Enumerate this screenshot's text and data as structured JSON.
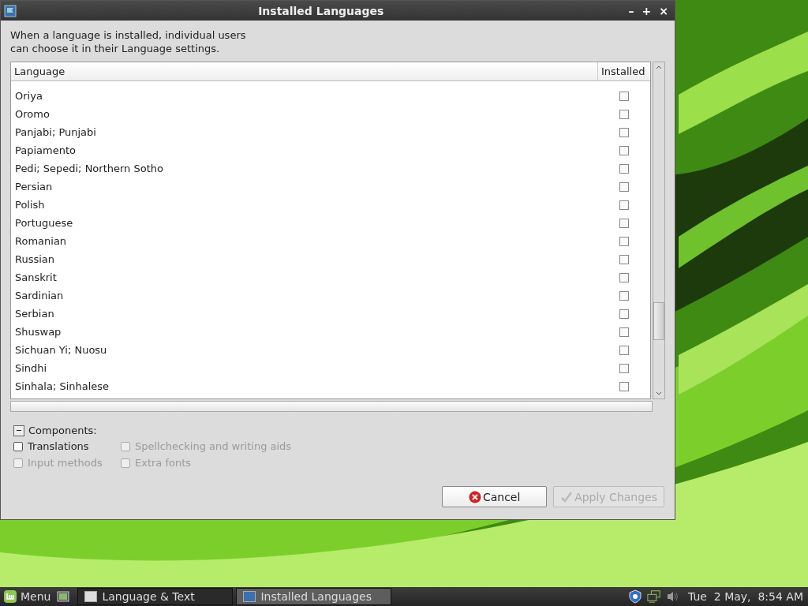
{
  "window": {
    "title": "Installed Languages",
    "controls": [
      "–",
      "+",
      "×"
    ]
  },
  "description": "When a language is installed, individual users\ncan choose it in their Language settings.",
  "table": {
    "columns": [
      "Language",
      "Installed"
    ],
    "rows": [
      {
        "name": "Oriya",
        "installed": false
      },
      {
        "name": "Oromo",
        "installed": false
      },
      {
        "name": "Panjabi; Punjabi",
        "installed": false
      },
      {
        "name": "Papiamento",
        "installed": false
      },
      {
        "name": "Pedi; Sepedi; Northern Sotho",
        "installed": false
      },
      {
        "name": "Persian",
        "installed": false
      },
      {
        "name": "Polish",
        "installed": false
      },
      {
        "name": "Portuguese",
        "installed": false
      },
      {
        "name": "Romanian",
        "installed": false
      },
      {
        "name": "Russian",
        "installed": false
      },
      {
        "name": "Sanskrit",
        "installed": false
      },
      {
        "name": "Sardinian",
        "installed": false
      },
      {
        "name": "Serbian",
        "installed": false
      },
      {
        "name": "Shuswap",
        "installed": false
      },
      {
        "name": "Sichuan Yi; Nuosu",
        "installed": false
      },
      {
        "name": "Sindhi",
        "installed": false
      },
      {
        "name": "Sinhala; Sinhalese",
        "installed": false
      }
    ]
  },
  "components": {
    "label": "Components:",
    "expanded": true,
    "options": [
      {
        "label": "Translations",
        "checked": false,
        "disabled": false
      },
      {
        "label": "Spellchecking and writing aids",
        "checked": false,
        "disabled": true
      },
      {
        "label": "Input methods",
        "checked": false,
        "disabled": true
      },
      {
        "label": "Extra fonts",
        "checked": false,
        "disabled": true
      }
    ]
  },
  "buttons": [
    {
      "label": "Cancel",
      "kind": "cancel",
      "disabled": false
    },
    {
      "label": "Apply Changes",
      "kind": "apply",
      "disabled": true
    }
  ],
  "taskbar": {
    "menu": "Menu",
    "tasks": [
      {
        "label": "Language & Text",
        "selected": false
      },
      {
        "label": "Installed Languages",
        "selected": true
      }
    ],
    "clock": "Tue  2 May,  8:54 AM"
  }
}
